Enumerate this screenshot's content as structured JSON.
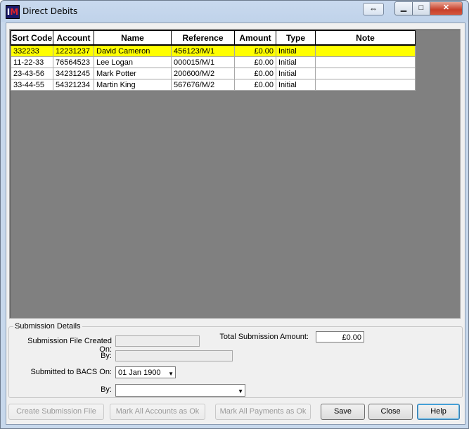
{
  "window": {
    "title": "Direct Debits"
  },
  "titlebar": {
    "swap_glyph": "⇔",
    "min_glyph": "▁",
    "max_glyph": "□",
    "close_glyph": "✕"
  },
  "grid": {
    "columns": [
      "Sort Code",
      "Account",
      "Name",
      "Reference",
      "Amount",
      "Type",
      "Note"
    ],
    "rows": [
      [
        "332233",
        "12231237",
        "David Cameron",
        "456123/M/1",
        "£0.00",
        "Initial",
        ""
      ],
      [
        "11-22-33",
        "76564523",
        "Lee Logan",
        "000015/M/1",
        "£0.00",
        "Initial",
        ""
      ],
      [
        "23-43-56",
        "34231245",
        "Mark Potter",
        "200600/M/2",
        "£0.00",
        "Initial",
        ""
      ],
      [
        "33-44-55",
        "54321234",
        "Martin King",
        "567676/M/2",
        "£0.00",
        "Initial",
        ""
      ]
    ],
    "selected_row": 0,
    "highlight_color": "#ffff00"
  },
  "submission": {
    "legend": "Submission Details",
    "file_created_on_label": "Submission File Created On:",
    "file_created_on_value": "",
    "by_label": "By:",
    "by_value": "",
    "total_label": "Total Submission Amount:",
    "total_value": "£0.00",
    "submitted_label": "Submitted to BACS On:",
    "submitted_value": "01 Jan 1900",
    "submitted_by_label": "By:",
    "submitted_by_value": ""
  },
  "buttons": {
    "create_file": "Create Submission File",
    "mark_accounts": "Mark All Accounts as Ok",
    "mark_payments": "Mark All Payments as Ok",
    "save": "Save",
    "close": "Close",
    "help": "Help"
  },
  "colors": {
    "grid_background": "#808080",
    "close_button": "#c7402a"
  }
}
